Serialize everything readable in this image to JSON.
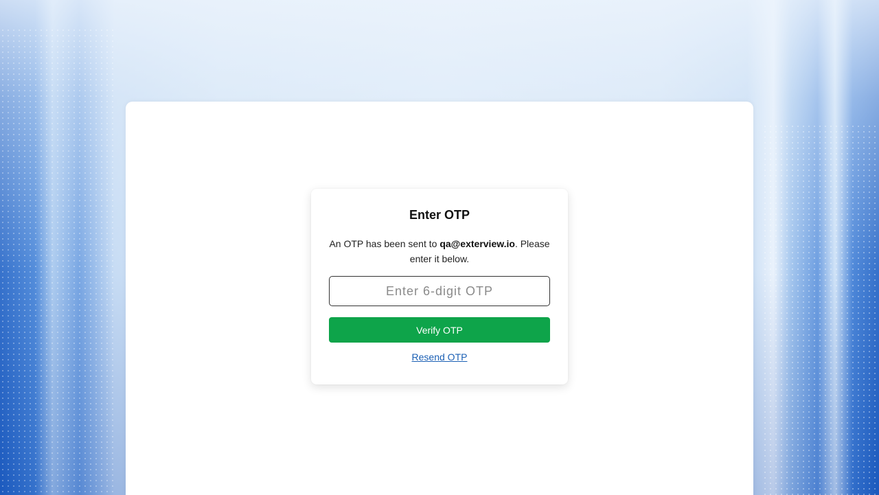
{
  "otp_card": {
    "title": "Enter OTP",
    "message_prefix": "An OTP has been sent to ",
    "email": "qa@exterview.io",
    "message_suffix": ". Please enter it below.",
    "input_placeholder": "Enter 6-digit OTP",
    "input_value": "",
    "verify_button_label": "Verify OTP",
    "resend_link_label": "Resend OTP"
  },
  "colors": {
    "verify_button": "#0ea44a",
    "resend_link": "#1a5fb4"
  }
}
